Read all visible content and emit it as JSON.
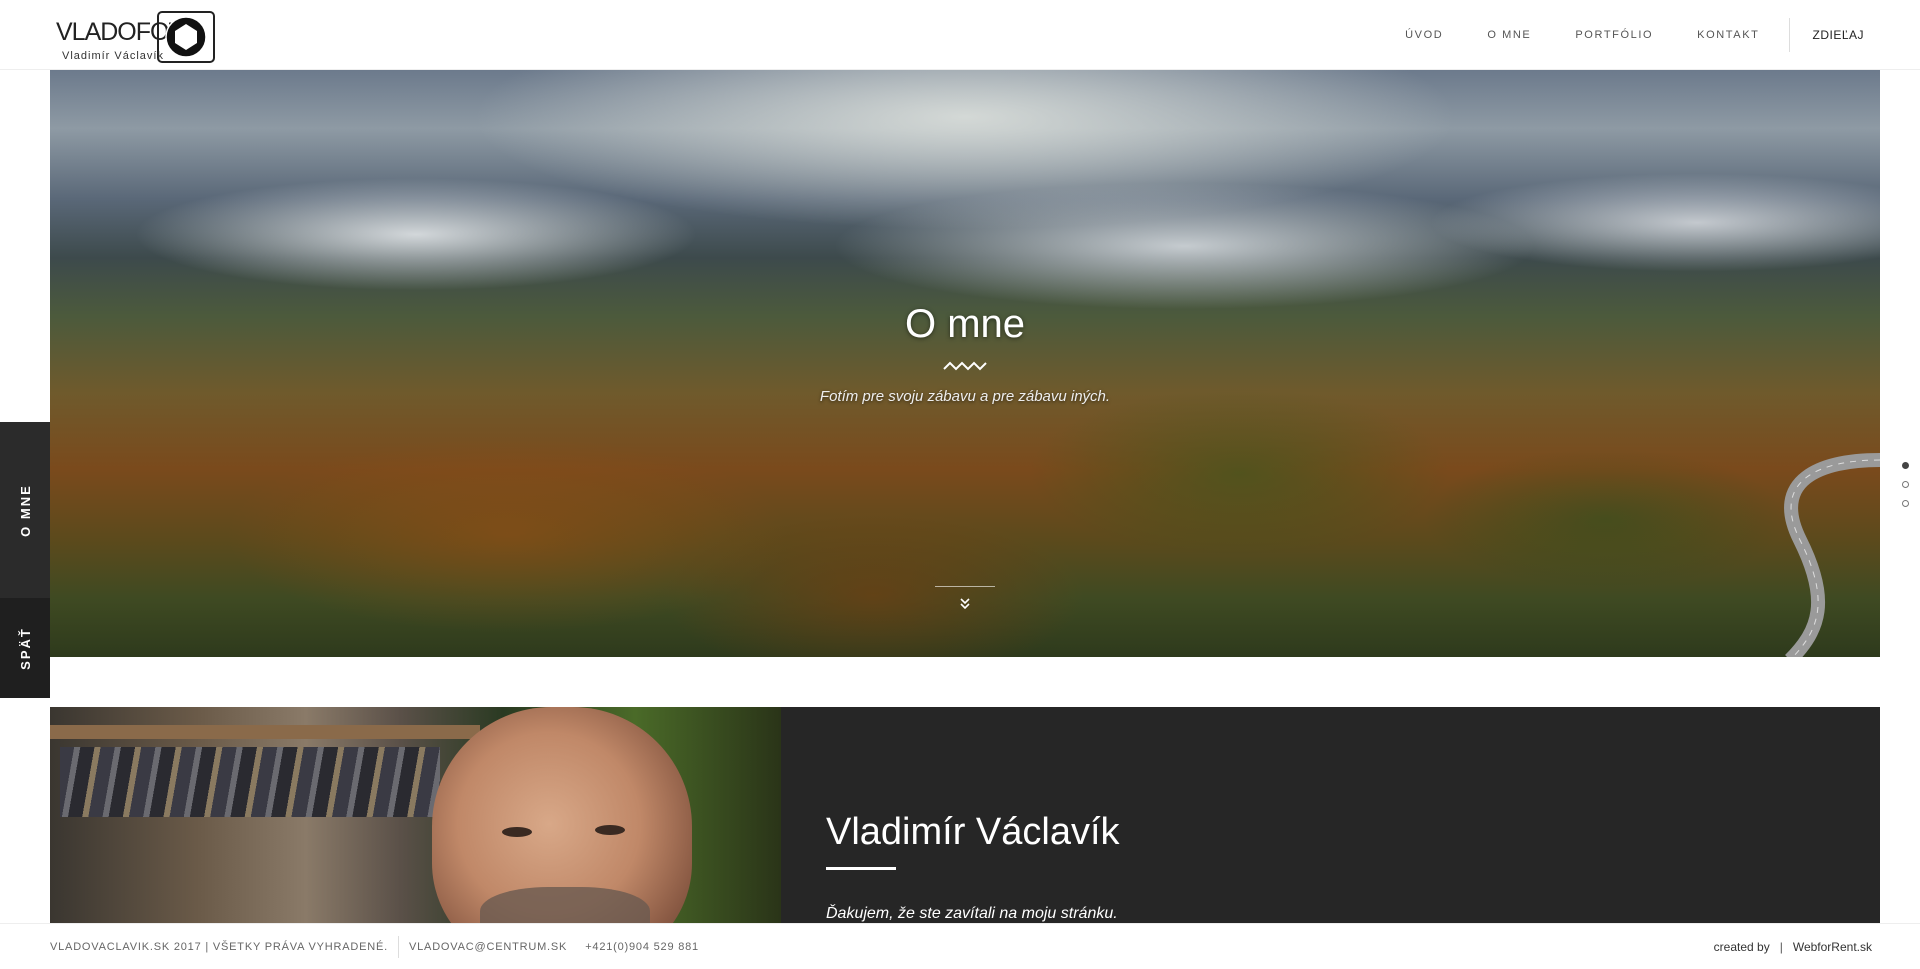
{
  "header": {
    "logo": {
      "wordmark": "VLADOFOT",
      "subtitle": "Vladimír Václavík"
    },
    "nav": [
      {
        "label": "ÚVOD"
      },
      {
        "label": "O MNE"
      },
      {
        "label": "PORTFÓLIO"
      },
      {
        "label": "KONTAKT"
      }
    ],
    "share_label": "ZDIEĽAJ"
  },
  "hero": {
    "title": "O mne",
    "subtitle": "Fotím pre svoju zábavu a pre zábavu iných.",
    "scroll_icon": "double-chevron-down-icon"
  },
  "side_tabs": {
    "current": "O MNE",
    "back": "SPÄŤ"
  },
  "dots": {
    "count": 3,
    "active_index": 0
  },
  "about": {
    "name": "Vladimír Václavík",
    "intro": "Ďakujem, že ste zavítali na moju stránku."
  },
  "footer": {
    "copyright": "VLADOVACLAVIK.SK 2017 | VŠETKY PRÁVA VYHRADENÉ.",
    "email": "VLADOVAC@CENTRUM.SK",
    "phone": "+421(0)904 529 881",
    "created_by_label": "created by",
    "separator": "|",
    "created_by_link": "WebforRent.sk"
  },
  "colors": {
    "dark_panel": "#262626",
    "side_tab": "#2b2b2b",
    "accent_text": "#ffffff"
  }
}
